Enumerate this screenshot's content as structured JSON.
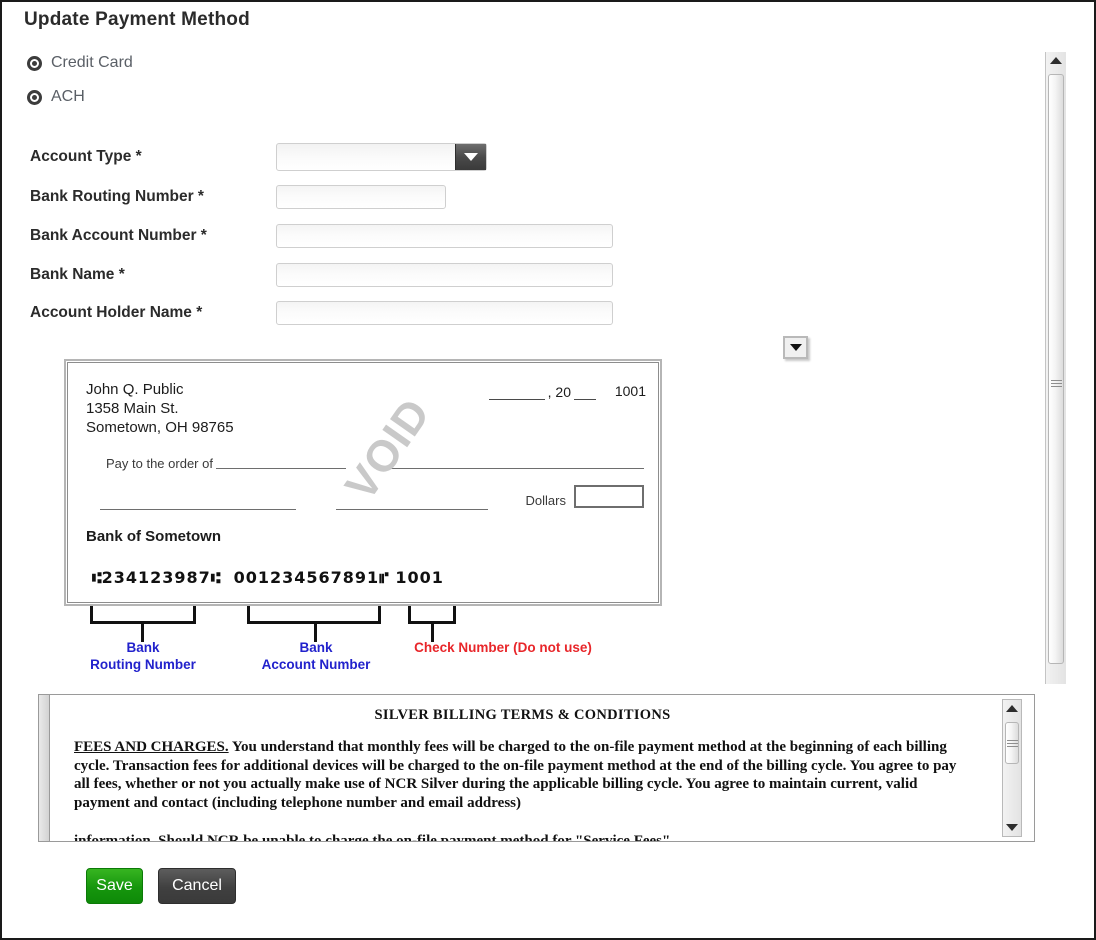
{
  "page": {
    "title": "Update Payment Method"
  },
  "payment_method": {
    "options": [
      {
        "label": "Credit Card",
        "selected": false
      },
      {
        "label": "ACH",
        "selected": true
      }
    ]
  },
  "form": {
    "fields": [
      {
        "label": "Account Type *",
        "value": "",
        "placeholder": "",
        "type": "select"
      },
      {
        "label": "Bank Routing Number *",
        "value": "",
        "placeholder": "",
        "type": "text"
      },
      {
        "label": "Bank Account Number *",
        "value": "",
        "placeholder": "",
        "type": "text"
      },
      {
        "label": "Bank Name *",
        "value": "",
        "placeholder": "",
        "type": "text"
      },
      {
        "label": "Account Holder Name *",
        "value": "",
        "placeholder": "",
        "type": "text"
      }
    ]
  },
  "check_sample": {
    "payer_name": "John Q. Public",
    "payer_street": "1358 Main St.",
    "payer_city_state_zip": "Sometown, OH 98765",
    "date_prefix": ", 20",
    "check_number_top": "1001",
    "pay_to_label": "Pay to the order of",
    "dollars_label": "Dollars",
    "bank_name": "Bank of Sometown",
    "watermark": "VOID",
    "micr_routing": "234123987",
    "micr_account": "001234567891",
    "micr_check": "1001",
    "micr_symbol_left": "⑆",
    "micr_symbol_right": "⑈",
    "annotations": [
      {
        "line1": "Bank",
        "line2": "Routing Number",
        "color": "#2222cc"
      },
      {
        "line1": "Bank",
        "line2": "Account Number",
        "color": "#2222cc"
      },
      {
        "line1": "Check Number (Do not use)",
        "line2": "",
        "color": "#e8262a"
      }
    ]
  },
  "terms": {
    "title": "SILVER BILLING TERMS & CONDITIONS",
    "lead": "FEES AND CHARGES.",
    "body": " You understand that monthly fees will be charged to the on-file payment method at the beginning of each billing cycle. Transaction fees for additional devices will be charged to the on-file payment method at the end of the billing cycle. You agree to pay all fees, whether or not you actually make use of NCR Silver during the applicable billing cycle. You agree to maintain current, valid payment and contact (including telephone number and email address)",
    "clipped_line": "information. Should NCR be unable to charge the on-file payment method for \"Service Fees\""
  },
  "actions": {
    "save_label": "Save",
    "cancel_label": "Cancel",
    "save_color": "#16960d",
    "cancel_color": "#404040"
  }
}
